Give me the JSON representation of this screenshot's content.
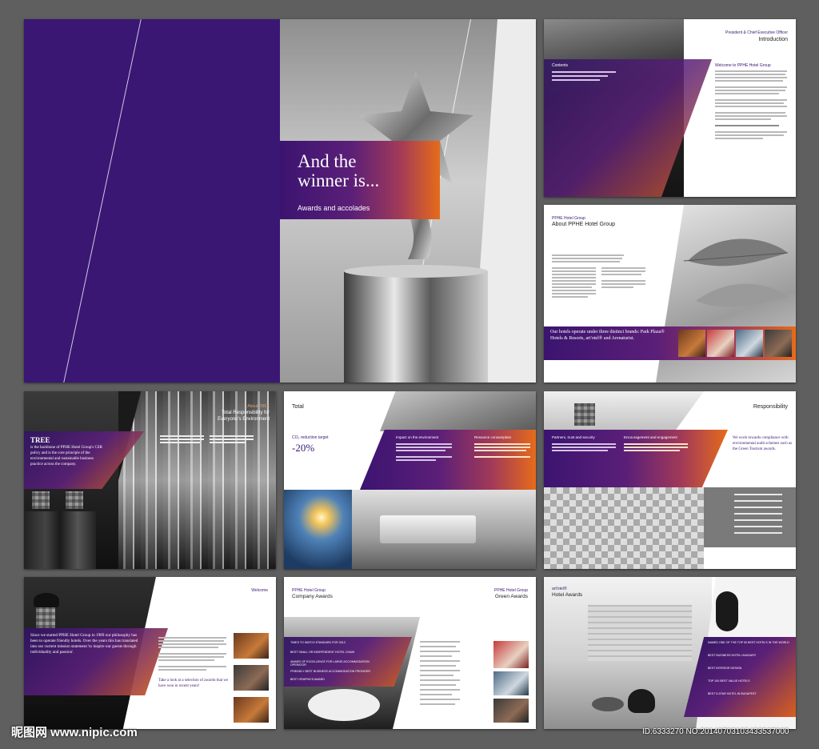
{
  "colors": {
    "purple": "#3a1773",
    "orange": "#e66b1a",
    "bg": "#5f5f5f"
  },
  "cover": {
    "title_line1": "And the",
    "title_line2": "winner is...",
    "subtitle": "Awards and accolades"
  },
  "intro": {
    "kicker": "President & Chief Executive Officer",
    "title": "Introduction",
    "heading": "Welcome to PPHE Hotel Group",
    "contents_label": "Contents"
  },
  "about": {
    "kicker": "PPHE Hotel Group",
    "title": "About PPHE Hotel Group",
    "brands_text": "Our hotels operate under three distinct brands: Park Plaza® Hotels & Resorts, art'otel® and Arenaturist."
  },
  "tree": {
    "kicker": "About TREE",
    "title_line1": "Total Responsibility for",
    "title_line2": "Everyone's Environment",
    "heading": "TREE",
    "body": "is the backbone of PPHE Hotel Group's CSR policy and is the core principle of the environmental and sustainable business practice across the company."
  },
  "total": {
    "title": "Total",
    "stat_label": "CO₂ reduction target",
    "stat_value": "-20%",
    "col1_heading": "Impact on the environment",
    "col2_heading": "Resource consumption"
  },
  "responsibility": {
    "title": "Responsibility",
    "col1_heading": "Partners, trust and security",
    "col2_heading": "Encouragement and engagement",
    "quote": "We work towards compliance with environmental audit schemes such as the Green Tourism awards."
  },
  "welcome": {
    "title": "Welcome",
    "quote": "Since we started PPHE Hotel Group in 1989 our philosophy has been to operate friendly hotels. Over the years this has translated into our current mission statement 'to inspire our guests through individuality and passion'.",
    "cta": "Take a look at a selection of awards that we have won in recent years!"
  },
  "company_awards": {
    "kicker": "PPHE Hotel Group",
    "title": "Company Awards",
    "items": [
      "TIMES TO WATCH STANDARD FOR 2013",
      "BEST SMALL OR INDEPENDENT HOTEL CHAIN",
      "AWARD OF EXCELLENCE FOR LARGE ACCOMMODATION OPERATOR",
      "FRIENDLY BEST BUSINESS ACCOMMODATION PROVIDER",
      "BEST GRAPHICS AWARD"
    ]
  },
  "green_awards": {
    "kicker": "PPHE Hotel Group",
    "title": "Green Awards"
  },
  "hotel_awards": {
    "kicker": "art'otel®",
    "title": "Hotel Awards",
    "items": [
      "NAMED ONE OF THE TOP 50 BEST HOTELS IN THE WORLD",
      "BEST BUSINESS HOTEL HUNGARY",
      "BEST INTERIOR DESIGN",
      "TOP 100 BEST VALUE HOTELS",
      "BEST 5-STAR HOTEL IN BUDAPEST"
    ]
  },
  "watermark": {
    "logo": "昵图网 www.nipic.com",
    "id": "ID:6333270 NO:20140703103433537000"
  }
}
